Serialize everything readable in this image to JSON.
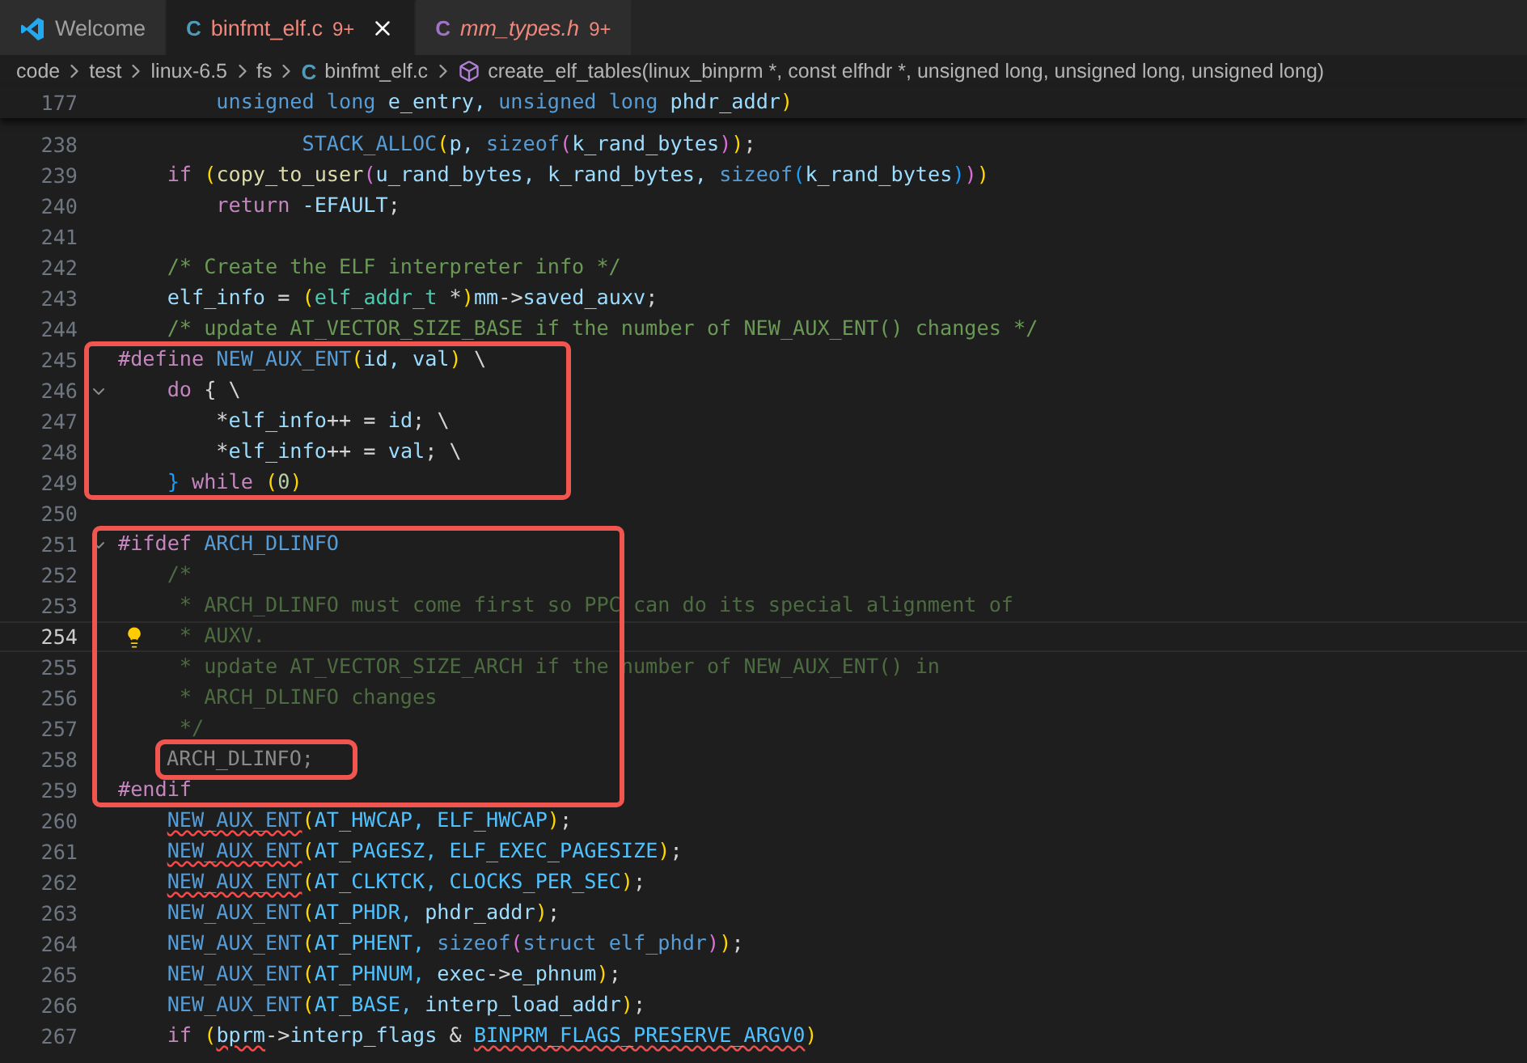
{
  "tabs": [
    {
      "label": "Welcome",
      "kind": "welcome",
      "selected": false,
      "preview": false
    },
    {
      "label": "binfmt_elf.c",
      "kind": "c",
      "icon_text": "C",
      "badge": "9+",
      "selected": true,
      "preview": false
    },
    {
      "label": "mm_types.h",
      "kind": "h",
      "icon_text": "C",
      "badge": "9+",
      "selected": false,
      "preview": true
    }
  ],
  "breadcrumb": [
    {
      "label": "code",
      "kind": "folder"
    },
    {
      "label": "test",
      "kind": "folder"
    },
    {
      "label": "linux-6.5",
      "kind": "folder"
    },
    {
      "label": "fs",
      "kind": "folder"
    },
    {
      "label": "binfmt_elf.c",
      "kind": "c",
      "icon_text": "C"
    },
    {
      "label": "create_elf_tables(linux_binprm *, const elfhdr *, unsigned long, unsigned long, unsigned long)",
      "kind": "symbol"
    }
  ],
  "editor": {
    "sticky_line": {
      "number": "177",
      "tokens": [
        {
          "text": "        unsigned ",
          "kind": "kw"
        },
        {
          "text": "long ",
          "kind": "kw"
        },
        {
          "text": "e_entry, ",
          "kind": "var"
        },
        {
          "text": "unsigned ",
          "kind": "kw"
        },
        {
          "text": "long ",
          "kind": "kw"
        },
        {
          "text": "phdr_addr",
          "kind": "var"
        },
        {
          "text": ")",
          "kind": "b1"
        }
      ]
    },
    "blocks": [
      {
        "lines": [
          {
            "number": "238",
            "tokens": [
              {
                "text": "               STACK_ALLOC",
                "kind": "macro"
              },
              {
                "text": "(",
                "kind": "b1"
              },
              {
                "text": "p, ",
                "kind": "var"
              },
              {
                "text": "sizeof",
                "kind": "kw"
              },
              {
                "text": "(",
                "kind": "b2"
              },
              {
                "text": "k_rand_bytes",
                "kind": "var"
              },
              {
                "text": ")",
                "kind": "b2"
              },
              {
                "text": ")",
                "kind": "b1"
              },
              {
                "text": ";",
                "kind": "text"
              }
            ]
          },
          {
            "number": "239",
            "tokens": [
              {
                "text": "    if ",
                "kind": "ctrl"
              },
              {
                "text": "(",
                "kind": "b1"
              },
              {
                "text": "copy_to_user",
                "kind": "fn"
              },
              {
                "text": "(",
                "kind": "b2"
              },
              {
                "text": "u_rand_bytes, ",
                "kind": "var"
              },
              {
                "text": "k_rand_bytes, ",
                "kind": "var"
              },
              {
                "text": "sizeof",
                "kind": "kw"
              },
              {
                "text": "(",
                "kind": "b3"
              },
              {
                "text": "k_rand_bytes",
                "kind": "var"
              },
              {
                "text": ")",
                "kind": "b3"
              },
              {
                "text": ")",
                "kind": "b2"
              },
              {
                "text": ")",
                "kind": "b1"
              }
            ]
          },
          {
            "number": "240",
            "tokens": [
              {
                "text": "        return ",
                "kind": "ctrl"
              },
              {
                "text": "-EFAULT",
                "kind": "var"
              },
              {
                "text": ";",
                "kind": "text"
              }
            ]
          },
          {
            "number": "241"
          },
          {
            "number": "242",
            "tokens": [
              {
                "text": "    /* Create the ELF interpreter info */",
                "kind": "comment"
              }
            ]
          },
          {
            "number": "243",
            "tokens": [
              {
                "text": "    elf_info",
                "kind": "var"
              },
              {
                "text": " = ",
                "kind": "text"
              },
              {
                "text": "(",
                "kind": "b1"
              },
              {
                "text": "elf_addr_t",
                "kind": "type"
              },
              {
                "text": " *",
                "kind": "text"
              },
              {
                "text": ")",
                "kind": "b1"
              },
              {
                "text": "mm",
                "kind": "var"
              },
              {
                "text": "->",
                "kind": "text"
              },
              {
                "text": "saved_auxv",
                "kind": "var"
              },
              {
                "text": ";",
                "kind": "text"
              }
            ]
          },
          {
            "number": "244",
            "tokens": [
              {
                "text": "    /* update AT_VECTOR_SIZE_BASE if the number of NEW_AUX_ENT() changes */",
                "kind": "comment"
              }
            ]
          }
        ]
      },
      {
        "boxed": true,
        "lines": [
          {
            "number": "245",
            "tokens": [
              {
                "text": "#define ",
                "kind": "ctrl"
              },
              {
                "text": "NEW_AUX_ENT",
                "kind": "macro"
              },
              {
                "text": "(",
                "kind": "b1"
              },
              {
                "text": "id, ",
                "kind": "var"
              },
              {
                "text": "val",
                "kind": "var"
              },
              {
                "text": ")",
                "kind": "b1"
              },
              {
                "text": " \\",
                "kind": "text"
              }
            ]
          },
          {
            "number": "246",
            "fold": true,
            "tokens": [
              {
                "text": "    do",
                "kind": "ctrl"
              },
              {
                "text": " { \\",
                "kind": "text"
              }
            ]
          },
          {
            "number": "247",
            "tokens": [
              {
                "text": "        *",
                "kind": "text"
              },
              {
                "text": "elf_info",
                "kind": "var"
              },
              {
                "text": "++ = ",
                "kind": "text"
              },
              {
                "text": "id",
                "kind": "var"
              },
              {
                "text": "; \\",
                "kind": "text"
              }
            ]
          },
          {
            "number": "248",
            "tokens": [
              {
                "text": "        *",
                "kind": "text"
              },
              {
                "text": "elf_info",
                "kind": "var"
              },
              {
                "text": "++ = ",
                "kind": "text"
              },
              {
                "text": "val",
                "kind": "var"
              },
              {
                "text": "; \\",
                "kind": "text"
              }
            ]
          },
          {
            "number": "249",
            "tokens": [
              {
                "text": "    } ",
                "kind": "b3"
              },
              {
                "text": "while ",
                "kind": "ctrl"
              },
              {
                "text": "(",
                "kind": "b1"
              },
              {
                "text": "0",
                "kind": "num"
              },
              {
                "text": ")",
                "kind": "b1"
              }
            ]
          }
        ]
      },
      {
        "lines": [
          {
            "number": "250"
          }
        ]
      },
      {
        "boxed": true,
        "lines": [
          {
            "number": "251",
            "fold": true,
            "tokens": [
              {
                "text": "#ifdef ",
                "kind": "ctrl"
              },
              {
                "text": "ARCH_DLINFO",
                "kind": "macro"
              }
            ]
          },
          {
            "number": "252",
            "tokens": [
              {
                "text": "    /*",
                "kind": "dim"
              }
            ]
          },
          {
            "number": "253",
            "tokens": [
              {
                "text": "     * ARCH_DLINFO must come first so PPC can do its special alignment of",
                "kind": "dim"
              }
            ]
          },
          {
            "number": "254",
            "current": true,
            "lightbulb": true,
            "tokens": [
              {
                "text": "     * AUXV.",
                "kind": "dim"
              }
            ]
          },
          {
            "number": "255",
            "tokens": [
              {
                "text": "     * update AT_VECTOR_SIZE_ARCH if the number of NEW_AUX_ENT() in",
                "kind": "dim"
              }
            ]
          },
          {
            "number": "256",
            "tokens": [
              {
                "text": "     * ARCH_DLINFO changes",
                "kind": "dim"
              }
            ]
          },
          {
            "number": "257",
            "tokens": [
              {
                "text": "     */",
                "kind": "dim"
              }
            ]
          },
          {
            "number": "258",
            "tokens": [
              {
                "text": "ARCH_DLINFO;",
                "kind": "inactive",
                "boxed": true
              }
            ]
          },
          {
            "number": "259",
            "tokens": [
              {
                "text": "#endif",
                "kind": "ctrl"
              }
            ]
          }
        ]
      },
      {
        "lines": [
          {
            "number": "260",
            "tokens": [
              {
                "text": "    NEW_AUX_ENT",
                "kind": "macro",
                "squiggle": true
              },
              {
                "text": "(",
                "kind": "b1"
              },
              {
                "text": "AT_HWCAP, ",
                "kind": "const"
              },
              {
                "text": "ELF_HWCAP",
                "kind": "const"
              },
              {
                "text": ")",
                "kind": "b1"
              },
              {
                "text": ";",
                "kind": "text"
              }
            ]
          },
          {
            "number": "261",
            "tokens": [
              {
                "text": "    NEW_AUX_ENT",
                "kind": "macro",
                "squiggle": true
              },
              {
                "text": "(",
                "kind": "b1"
              },
              {
                "text": "AT_PAGESZ, ",
                "kind": "const"
              },
              {
                "text": "ELF_EXEC_PAGESIZE",
                "kind": "const"
              },
              {
                "text": ")",
                "kind": "b1"
              },
              {
                "text": ";",
                "kind": "text"
              }
            ]
          },
          {
            "number": "262",
            "tokens": [
              {
                "text": "    NEW_AUX_ENT",
                "kind": "macro",
                "squiggle": true
              },
              {
                "text": "(",
                "kind": "b1"
              },
              {
                "text": "AT_CLKTCK, ",
                "kind": "const"
              },
              {
                "text": "CLOCKS_PER_SEC",
                "kind": "const"
              },
              {
                "text": ")",
                "kind": "b1"
              },
              {
                "text": ";",
                "kind": "text"
              }
            ]
          },
          {
            "number": "263",
            "tokens": [
              {
                "text": "    NEW_AUX_ENT",
                "kind": "macro"
              },
              {
                "text": "(",
                "kind": "b1"
              },
              {
                "text": "AT_PHDR, ",
                "kind": "const"
              },
              {
                "text": "phdr_addr",
                "kind": "var"
              },
              {
                "text": ")",
                "kind": "b1"
              },
              {
                "text": ";",
                "kind": "text"
              }
            ]
          },
          {
            "number": "264",
            "tokens": [
              {
                "text": "    NEW_AUX_ENT",
                "kind": "macro"
              },
              {
                "text": "(",
                "kind": "b1"
              },
              {
                "text": "AT_PHENT, ",
                "kind": "const"
              },
              {
                "text": "sizeof",
                "kind": "kw"
              },
              {
                "text": "(",
                "kind": "b2"
              },
              {
                "text": "struct elf_phdr",
                "kind": "kw"
              },
              {
                "text": ")",
                "kind": "b2"
              },
              {
                "text": ")",
                "kind": "b1"
              },
              {
                "text": ";",
                "kind": "text"
              }
            ]
          },
          {
            "number": "265",
            "tokens": [
              {
                "text": "    NEW_AUX_ENT",
                "kind": "macro"
              },
              {
                "text": "(",
                "kind": "b1"
              },
              {
                "text": "AT_PHNUM, ",
                "kind": "const"
              },
              {
                "text": "exec",
                "kind": "var"
              },
              {
                "text": "->",
                "kind": "text"
              },
              {
                "text": "e_phnum",
                "kind": "var"
              },
              {
                "text": ")",
                "kind": "b1"
              },
              {
                "text": ";",
                "kind": "text"
              }
            ]
          },
          {
            "number": "266",
            "tokens": [
              {
                "text": "    NEW_AUX_ENT",
                "kind": "macro"
              },
              {
                "text": "(",
                "kind": "b1"
              },
              {
                "text": "AT_BASE, ",
                "kind": "const"
              },
              {
                "text": "interp_load_addr",
                "kind": "var"
              },
              {
                "text": ")",
                "kind": "b1"
              },
              {
                "text": ";",
                "kind": "text"
              }
            ]
          },
          {
            "number": "267",
            "tokens": [
              {
                "text": "    if ",
                "kind": "ctrl"
              },
              {
                "text": "(",
                "kind": "b1"
              },
              {
                "text": "bprm",
                "kind": "var",
                "squiggle": true
              },
              {
                "text": "->",
                "kind": "text"
              },
              {
                "text": "interp_flags",
                "kind": "var"
              },
              {
                "text": " & ",
                "kind": "text"
              },
              {
                "text": "BINPRM_FLAGS_PRESERVE_ARGV0",
                "kind": "const",
                "squiggle": true
              },
              {
                "text": ")",
                "kind": "b1"
              }
            ]
          }
        ]
      }
    ]
  }
}
